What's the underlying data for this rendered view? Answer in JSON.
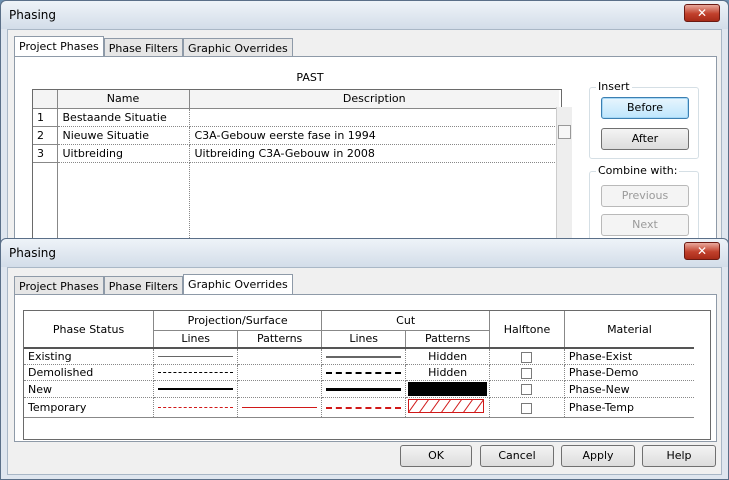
{
  "back_window": {
    "title": "Phasing",
    "close_label": "✕",
    "tabs": [
      "Project Phases",
      "Phase Filters",
      "Graphic Overrides"
    ],
    "direction_label": "PAST",
    "columns": [
      "Name",
      "Description"
    ],
    "rows": [
      {
        "num": "1",
        "name": "Bestaande Situatie",
        "description": ""
      },
      {
        "num": "2",
        "name": "Nieuwe Situatie",
        "description": "C3A-Gebouw eerste fase in 1994"
      },
      {
        "num": "3",
        "name": "Uitbreiding",
        "description": "Uitbreiding C3A-Gebouw in 2008"
      }
    ],
    "insert_group": "Insert",
    "before_label": "Before",
    "after_label": "After",
    "combine_group": "Combine with:",
    "previous_label": "Previous",
    "next_label": "Next"
  },
  "front_window": {
    "title": "Phasing",
    "close_label": "✕",
    "tabs": [
      "Project Phases",
      "Phase Filters",
      "Graphic Overrides"
    ],
    "headers": {
      "phase_status": "Phase Status",
      "projection": "Projection/Surface",
      "cut": "Cut",
      "lines": "Lines",
      "patterns": "Patterns",
      "halftone": "Halftone",
      "material": "Material"
    },
    "rows": [
      {
        "status": "Existing",
        "cut_pattern": "Hidden",
        "halftone": false,
        "material": "Phase-Exist"
      },
      {
        "status": "Demolished",
        "cut_pattern": "Hidden",
        "halftone": false,
        "material": "Phase-Demo"
      },
      {
        "status": "New",
        "cut_pattern": "",
        "halftone": false,
        "material": "Phase-New"
      },
      {
        "status": "Temporary",
        "cut_pattern": "",
        "halftone": false,
        "material": "Phase-Temp"
      }
    ],
    "ok_label": "OK",
    "cancel_label": "Cancel",
    "apply_label": "Apply",
    "help_label": "Help"
  },
  "colors": {
    "temporary": "#d01818",
    "new_fill": "#000000"
  }
}
